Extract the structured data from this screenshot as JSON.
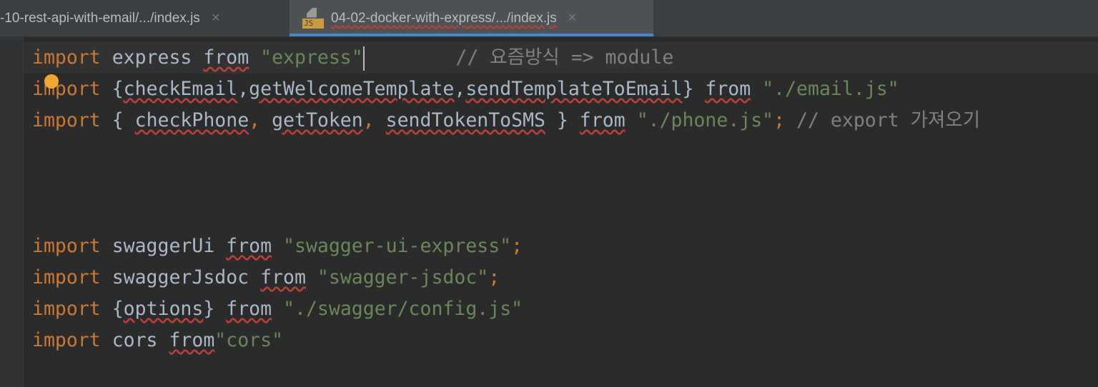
{
  "tabs": [
    {
      "label": "-10-rest-api-with-email/.../index.js",
      "active": false
    },
    {
      "label": "04-02-docker-with-express/.../index.js",
      "active": true,
      "icon": "js-file-icon",
      "badge": "JS"
    }
  ],
  "close_glyph": "×",
  "colors": {
    "keyword": "#cc7832",
    "string": "#6a8759",
    "comment": "#808080",
    "identifier": "#a9b7c6",
    "accent": "#4a88c7"
  },
  "lines": [
    [
      [
        "kw",
        "import"
      ],
      [
        "id",
        " express "
      ],
      [
        "id",
        "from",
        "w"
      ],
      [
        "id",
        " "
      ],
      [
        "str",
        "\"express\""
      ],
      [
        "caret",
        ""
      ],
      [
        "id",
        "        "
      ],
      [
        "cm",
        "// 요즘방식 => module"
      ]
    ],
    [
      [
        "kw",
        "import"
      ],
      [
        "id",
        " {"
      ],
      [
        "id",
        "checkEmail",
        "w"
      ],
      [
        "id",
        ","
      ],
      [
        "id",
        "getWelcomeTemplate",
        "w"
      ],
      [
        "id",
        ","
      ],
      [
        "id",
        "sendTemplateToEmail",
        "w"
      ],
      [
        "id",
        "} "
      ],
      [
        "id",
        "from",
        "w"
      ],
      [
        "id",
        " "
      ],
      [
        "str",
        "\"./email.js\""
      ]
    ],
    [
      [
        "kw",
        "import"
      ],
      [
        "id",
        " { "
      ],
      [
        "id",
        "checkPhone",
        "w"
      ],
      [
        "punc",
        ", "
      ],
      [
        "id",
        "getToken",
        "w"
      ],
      [
        "punc",
        ", "
      ],
      [
        "id",
        "sendTokenToSMS",
        "w"
      ],
      [
        "id",
        " } "
      ],
      [
        "id",
        "from",
        "w"
      ],
      [
        "id",
        " "
      ],
      [
        "str",
        "\"./phone.js\""
      ],
      [
        "punc",
        ";"
      ],
      [
        "cm",
        " // export 가져오기"
      ]
    ],
    [],
    [],
    [],
    [
      [
        "kw",
        "import"
      ],
      [
        "id",
        " swaggerUi "
      ],
      [
        "id",
        "from",
        "w"
      ],
      [
        "id",
        " "
      ],
      [
        "str",
        "\"swagger-ui-express\""
      ],
      [
        "punc",
        ";"
      ]
    ],
    [
      [
        "kw",
        "import"
      ],
      [
        "id",
        " swaggerJsdoc "
      ],
      [
        "id",
        "from",
        "w"
      ],
      [
        "id",
        " "
      ],
      [
        "str",
        "\"swagger-jsdoc\""
      ],
      [
        "punc",
        ";"
      ]
    ],
    [
      [
        "kw",
        "import"
      ],
      [
        "id",
        " {"
      ],
      [
        "id",
        "options",
        "w"
      ],
      [
        "id",
        "} "
      ],
      [
        "id",
        "from",
        "w"
      ],
      [
        "id",
        " "
      ],
      [
        "str",
        "\"./swagger/config.js\""
      ]
    ],
    [
      [
        "kw",
        "import"
      ],
      [
        "id",
        " cors "
      ],
      [
        "id",
        "from",
        "w"
      ],
      [
        "str",
        "\"cors\""
      ]
    ]
  ]
}
